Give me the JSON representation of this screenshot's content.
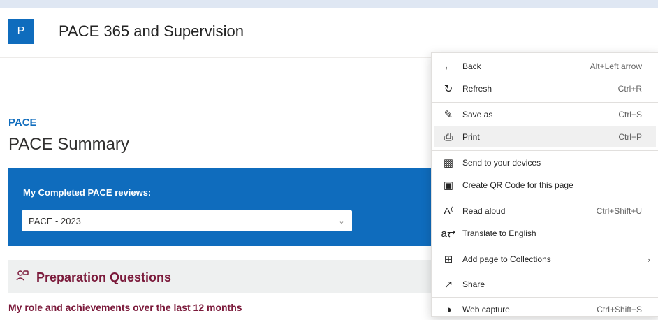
{
  "site": {
    "logo_letter": "P",
    "title": "PACE 365 and Supervision"
  },
  "page": {
    "eyebrow": "PACE",
    "title": "PACE Summary"
  },
  "panel": {
    "label": "My Completed PACE reviews:",
    "dropdown_value": "PACE - 2023"
  },
  "section": {
    "title": "Preparation Questions",
    "subheading": "My role and achievements over the last 12 months"
  },
  "context_menu": {
    "items": [
      {
        "label": "Back",
        "shortcut": "Alt+Left arrow",
        "icon": "back-arrow-icon"
      },
      {
        "label": "Refresh",
        "shortcut": "Ctrl+R",
        "icon": "refresh-icon"
      },
      {
        "label": "Save as",
        "shortcut": "Ctrl+S",
        "icon": "save-as-icon"
      },
      {
        "label": "Print",
        "shortcut": "Ctrl+P",
        "icon": "print-icon"
      },
      {
        "label": "Send to your devices",
        "shortcut": "",
        "icon": "send-to-devices-icon"
      },
      {
        "label": "Create QR Code for this page",
        "shortcut": "",
        "icon": "qr-code-icon"
      },
      {
        "label": "Read aloud",
        "shortcut": "Ctrl+Shift+U",
        "icon": "read-aloud-icon"
      },
      {
        "label": "Translate to English",
        "shortcut": "",
        "icon": "translate-icon"
      },
      {
        "label": "Add page to Collections",
        "shortcut": "",
        "icon": "collections-icon"
      },
      {
        "label": "Share",
        "shortcut": "",
        "icon": "share-icon"
      },
      {
        "label": "Web capture",
        "shortcut": "Ctrl+Shift+S",
        "icon": "web-capture-icon"
      }
    ]
  },
  "colors": {
    "brand_blue": "#0f6cbd",
    "section_accent": "#7b1a3b"
  }
}
